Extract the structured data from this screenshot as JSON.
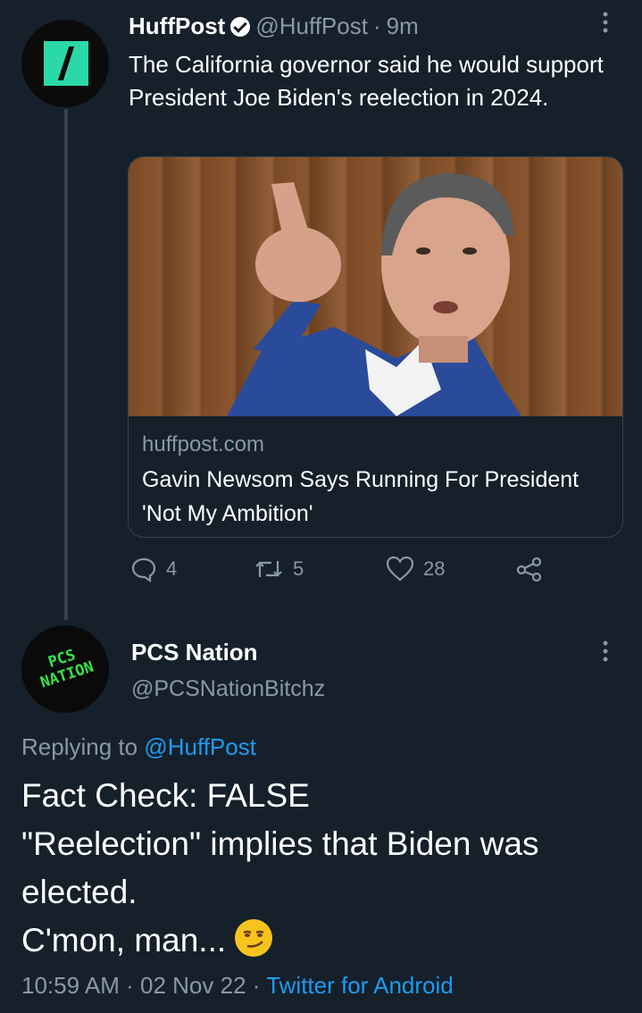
{
  "tweet1": {
    "name": "HuffPost",
    "handle": "@HuffPost",
    "time": "9m",
    "text": "The California governor said he would support President Joe Biden's reelection in 2024.",
    "card": {
      "domain": "huffpost.com",
      "title": "Gavin Newsom Says Running For President 'Not My Ambition'"
    },
    "counts": {
      "replies": "4",
      "retweets": "5",
      "likes": "28"
    },
    "icons": [
      "reply-icon",
      "retweet-icon",
      "like-icon",
      "share-icon",
      "verified-badge-icon",
      "more-options-icon"
    ]
  },
  "tweet2": {
    "name": "PCS Nation",
    "handle": "@PCSNationBitchz",
    "replying_prefix": "Replying to",
    "replying_to": "@HuffPost",
    "lines": [
      "Fact Check: FALSE",
      "\"Reelection\" implies that Biden was elected.",
      "C'mon, man..."
    ],
    "emoji_name": "smirking-face-emoji",
    "avatar_text_top": "PCS",
    "avatar_text_bottom": "NATION",
    "timestamp": "10:59 AM",
    "date": "02 Nov 22",
    "source": "Twitter for Android"
  },
  "colors": {
    "background": "#15202b",
    "text": "#ffffff",
    "muted": "#8b98a5",
    "link": "#1d9bf0",
    "border": "#38444d"
  }
}
